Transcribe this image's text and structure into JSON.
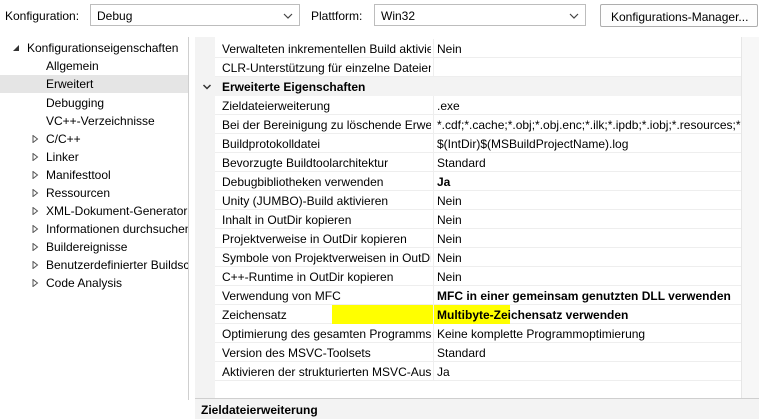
{
  "toolbar": {
    "config_label": "Konfiguration:",
    "config_value": "Debug",
    "platform_label": "Plattform:",
    "platform_value": "Win32",
    "config_manager_button": "Konfigurations-Manager..."
  },
  "tree": {
    "root": "Konfigurationseigenschaften",
    "items": [
      {
        "label": "Allgemein",
        "expandable": false
      },
      {
        "label": "Erweitert",
        "expandable": false,
        "selected": true
      },
      {
        "label": "Debugging",
        "expandable": false
      },
      {
        "label": "VC++-Verzeichnisse",
        "expandable": false
      },
      {
        "label": "C/C++",
        "expandable": true
      },
      {
        "label": "Linker",
        "expandable": true
      },
      {
        "label": "Manifesttool",
        "expandable": true
      },
      {
        "label": "Ressourcen",
        "expandable": true
      },
      {
        "label": "XML-Dokument-Generator",
        "expandable": true
      },
      {
        "label": "Informationen durchsuchen",
        "expandable": true
      },
      {
        "label": "Buildereignisse",
        "expandable": true
      },
      {
        "label": "Benutzerdefinierter Buildschritt",
        "expandable": true
      },
      {
        "label": "Code Analysis",
        "expandable": true
      }
    ]
  },
  "grid": {
    "rows_top": [
      {
        "name": "Verwalteten inkrementellen Build aktivieren",
        "value": "Nein"
      },
      {
        "name": "CLR-Unterstützung für einzelne Dateien",
        "value": ""
      }
    ],
    "category": "Erweiterte Eigenschaften",
    "rows": [
      {
        "name": "Zieldateierweiterung",
        "value": ".exe",
        "bold": false
      },
      {
        "name": "Bei der Bereinigung zu löschende Erweiterungen",
        "value": "*.cdf;*.cache;*.obj;*.obj.enc;*.ilk;*.ipdb;*.iobj;*.resources;*.tlb",
        "bold": false
      },
      {
        "name": "Buildprotokolldatei",
        "value": "$(IntDir)$(MSBuildProjectName).log",
        "bold": false
      },
      {
        "name": "Bevorzugte Buildtoolarchitektur",
        "value": "Standard",
        "bold": false
      },
      {
        "name": "Debugbibliotheken verwenden",
        "value": "Ja",
        "bold": true
      },
      {
        "name": "Unity (JUMBO)-Build aktivieren",
        "value": "Nein",
        "bold": false
      },
      {
        "name": "Inhalt in OutDir kopieren",
        "value": "Nein",
        "bold": false
      },
      {
        "name": "Projektverweise in OutDir kopieren",
        "value": "Nein",
        "bold": false
      },
      {
        "name": "Symbole von Projektverweisen in OutDir kopieren",
        "value": "Nein",
        "bold": false
      },
      {
        "name": "C++-Runtime in OutDir kopieren",
        "value": "Nein",
        "bold": false
      },
      {
        "name": "Verwendung von MFC",
        "value": "MFC in einer gemeinsam genutzten DLL verwenden",
        "bold": true
      },
      {
        "name": "Zeichensatz",
        "value": "Multibyte-Zeichensatz verwenden",
        "bold": true,
        "highlight": "#ffff00"
      },
      {
        "name": "Optimierung des gesamten Programms",
        "value": "Keine komplette Programmoptimierung",
        "bold": false
      },
      {
        "name": "Version des MSVC-Toolsets",
        "value": "Standard",
        "bold": false
      },
      {
        "name": "Aktivieren der strukturierten MSVC-Ausgabe",
        "value": "Ja",
        "bold": false
      }
    ]
  },
  "description": {
    "title": "Zieldateierweiterung"
  },
  "colors": {
    "selection": "#e5e5e5",
    "category_bg": "#f3f3f3",
    "highlight": "#ffff00"
  }
}
